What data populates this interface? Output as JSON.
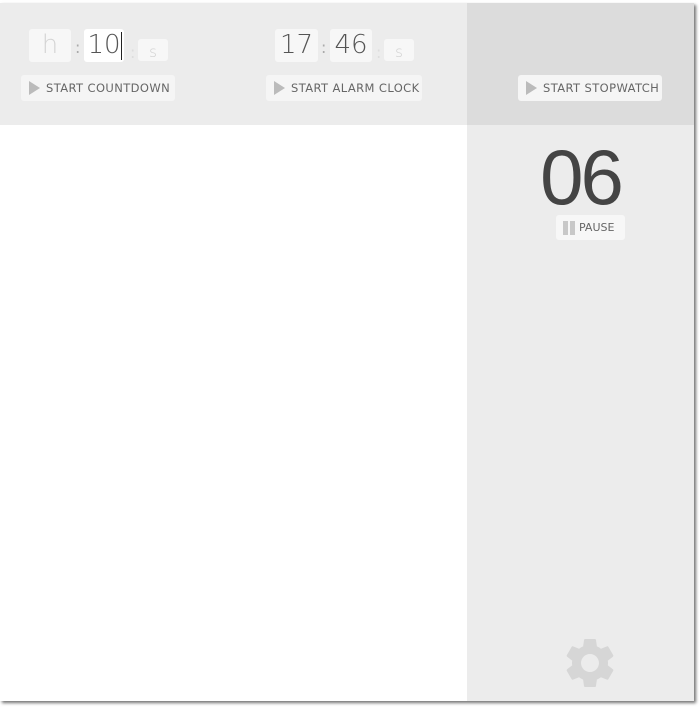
{
  "countdown": {
    "hours_placeholder": "h",
    "minutes_value": "10",
    "seconds_placeholder": "s",
    "separator": ":",
    "button_label": "START  COUNTDOWN"
  },
  "alarm": {
    "hours_value": "17",
    "minutes_value": "46",
    "seconds_placeholder": "s",
    "separator": ":",
    "button_label": "START  ALARM CLOCK"
  },
  "stopwatch": {
    "button_label": "START  STOPWATCH",
    "display": "06",
    "pause_label": "PAUSE"
  },
  "settings": {
    "icon": "gear-icon"
  }
}
